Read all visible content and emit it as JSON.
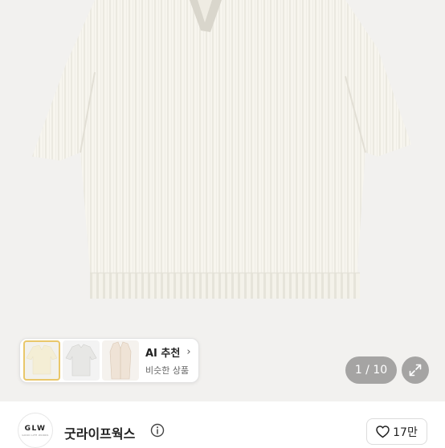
{
  "ai_card": {
    "title": "AI 추천",
    "subtitle": "비슷한 상품",
    "thumbnails": [
      "cream-sweater-thumb",
      "gray-knit-thumb",
      "beige-shirt-thumb"
    ]
  },
  "pager": {
    "current": "1",
    "total": "10",
    "label": "1 / 10"
  },
  "seller": {
    "name": "굿라이프웍스",
    "logo_text": "GLW",
    "logo_subtext": "GOOD LIFE WORKS"
  },
  "like": {
    "count_label": "17만"
  },
  "colors": {
    "accent_selected": "#e9c76a",
    "sweater": "#f7f5ee",
    "background": "#f2f1ef"
  }
}
